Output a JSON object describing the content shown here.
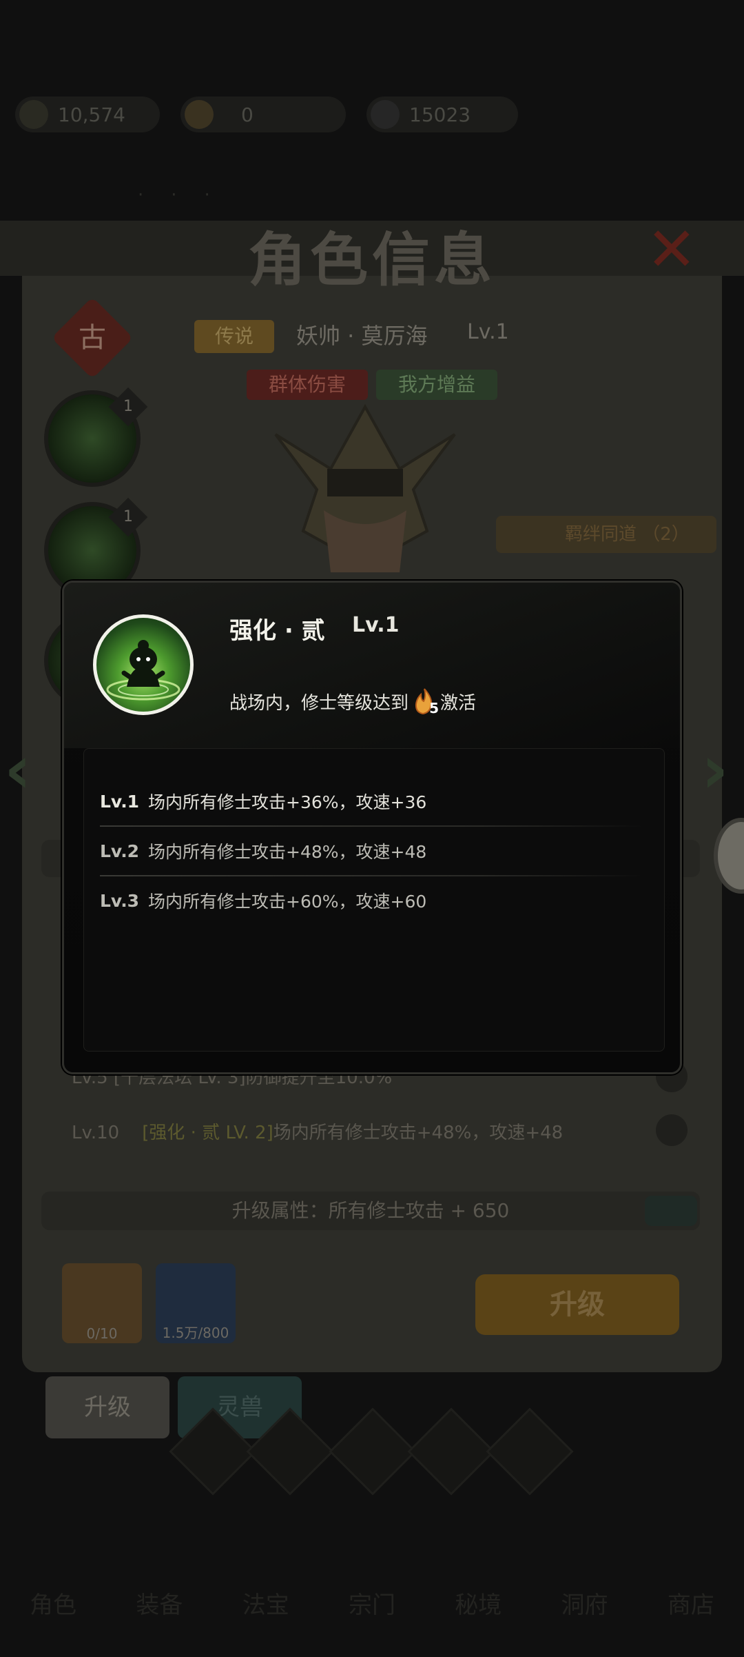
{
  "resources": [
    {
      "name": "gold",
      "value": "10,574"
    },
    {
      "name": "ingot",
      "value": "0"
    },
    {
      "name": "jade",
      "value": "15023"
    }
  ],
  "panel": {
    "title": "角色信息",
    "rank_char": "古",
    "rank_tag": "传说",
    "hero_name": "妖帅 · 莫厉海",
    "hero_level": "Lv.1",
    "tags": [
      "群体伤害",
      "我方增益"
    ],
    "skill_badges": [
      "1",
      "1"
    ],
    "fate_label": "羁绊同道 （2）",
    "partial_row": "Lv.5 [千层法坛 LV. 3]防御提升至10.0%",
    "row_lv10": {
      "level": "Lv.10",
      "bracket": "[强化 · 贰 LV. 2]",
      "text": "场内所有修士攻击+48%，攻速+48"
    },
    "upgrade_attr": "升级属性：所有修士攻击 + 650",
    "materials": [
      {
        "name": "hero-fragment",
        "count": "0/10"
      },
      {
        "name": "spirit-flame",
        "count": "1.5万/800"
      }
    ],
    "upgrade_button": "升级",
    "bottom_tabs": [
      "升级",
      "灵兽"
    ],
    "bottom_nav": [
      "角色",
      "装备",
      "法宝",
      "宗门",
      "秘境",
      "洞府",
      "商店"
    ]
  },
  "popup": {
    "title": "强化 · 贰",
    "level": "Lv.1",
    "condition_prefix": "战场内，修士等级达到",
    "condition_value": "5",
    "condition_suffix": "激活",
    "effects": [
      {
        "level": "Lv.1",
        "text": "场内所有修士攻击+36%，攻速+36"
      },
      {
        "level": "Lv.2",
        "text": "场内所有修士攻击+48%，攻速+48"
      },
      {
        "level": "Lv.3",
        "text": "场内所有修士攻击+60%，攻速+60"
      }
    ]
  },
  "colors": {
    "accent_gold": "#e9a23b",
    "popup_bg": "#0a0a0a",
    "skill_green": "#6cc04a"
  }
}
